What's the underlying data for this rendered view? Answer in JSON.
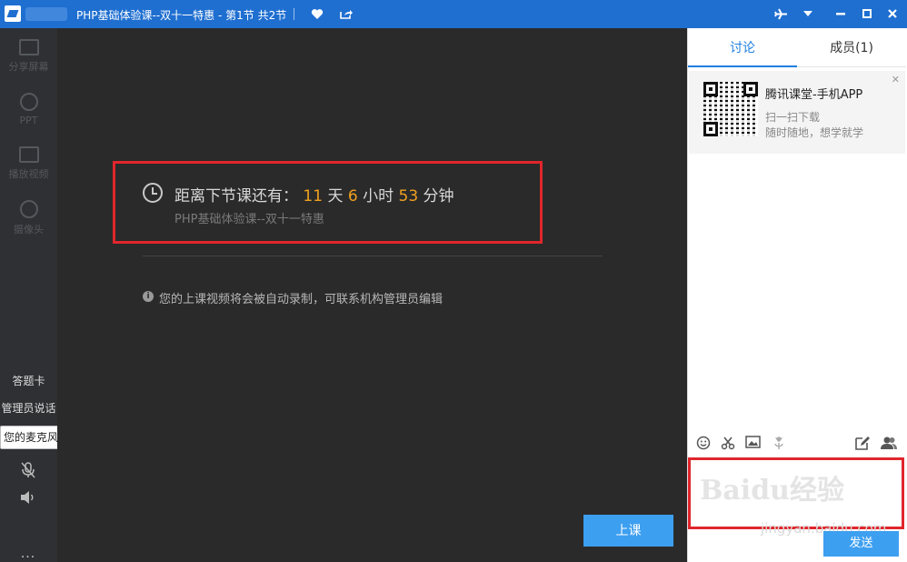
{
  "window": {
    "title": "PHP基础体验课--双十一特惠 - 第1节 共2节"
  },
  "leftbar": {
    "items": [
      {
        "label": "分享屏幕",
        "icon": "share-screen-icon"
      },
      {
        "label": "PPT",
        "icon": "ppt-icon"
      },
      {
        "label": "播放视频",
        "icon": "play-video-icon"
      },
      {
        "label": "摄像头",
        "icon": "camera-icon"
      }
    ],
    "answer_card": "答题卡",
    "admin_speak": "管理员说话",
    "tooltip": "您的麦克风默认为静音状态",
    "more": "..."
  },
  "main": {
    "countdown_prefix": "距离下节课还有：",
    "days": "11",
    "days_unit": "天",
    "hours": "6",
    "hours_unit": "小时",
    "minutes": "53",
    "minutes_unit": "分钟",
    "course_name": "PHP基础体验课--双十一特惠",
    "note": "您的上课视频将会被自动录制，可联系机构管理员编辑",
    "start_button": "上课"
  },
  "right": {
    "tabs": [
      {
        "label": "讨论",
        "active": true
      },
      {
        "label": "成员(1)",
        "active": false
      }
    ],
    "promo": {
      "title": "腾讯课堂-手机APP",
      "sub1": "扫一扫下载",
      "sub2": "随时随地，想学就学"
    },
    "watermark": "Baidu经验",
    "watermark_url": "jingyan.baidu.com",
    "send_button": "发送"
  },
  "colors": {
    "titlebar": "#1f6fd1",
    "accent": "#3d9ff0",
    "countdown_number": "#f0a020",
    "highlight_box": "#e0262b"
  }
}
